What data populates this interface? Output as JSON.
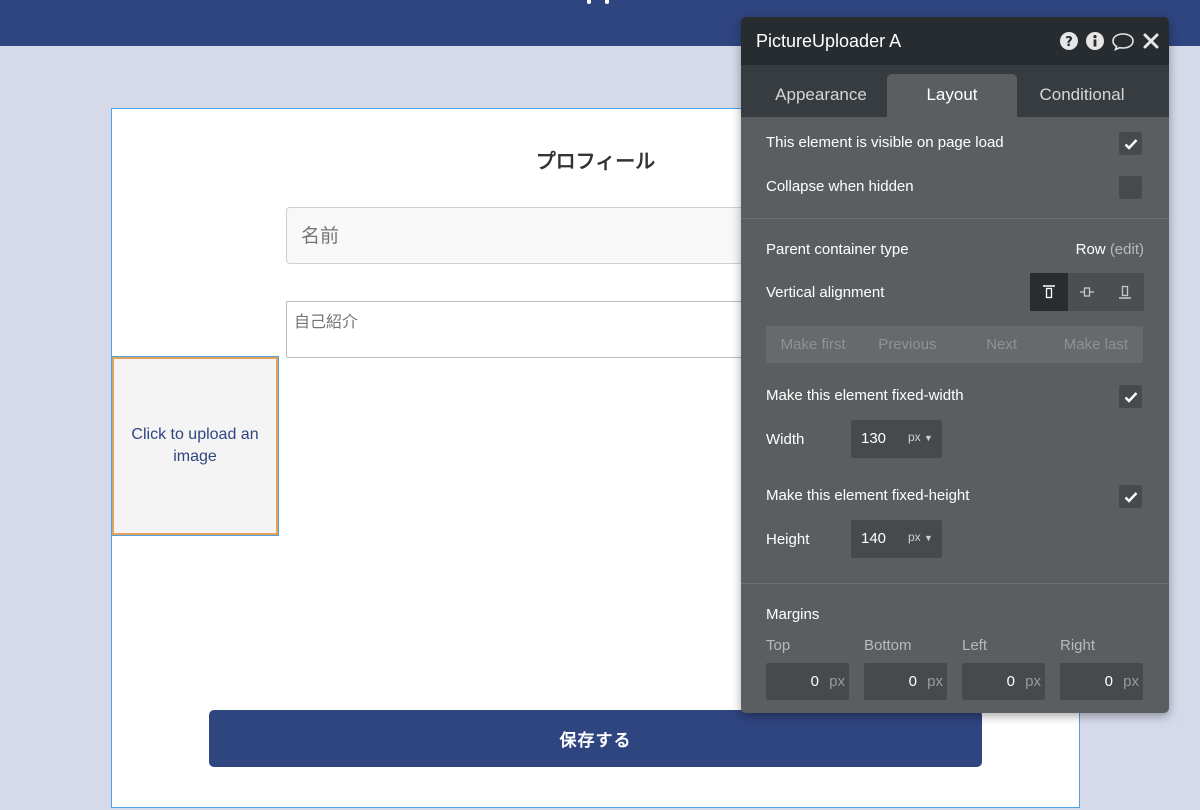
{
  "canvas": {
    "title": "プロフィール",
    "name_placeholder": "名前",
    "bio_placeholder": "自己紹介",
    "uploader_label": "Click to upload an image",
    "save_label": "保存する"
  },
  "panel": {
    "title": "PictureUploader A",
    "header_icons": [
      "help-icon",
      "info-icon",
      "comment-icon",
      "close-icon"
    ],
    "tabs": [
      {
        "label": "Appearance",
        "active": false
      },
      {
        "label": "Layout",
        "active": true
      },
      {
        "label": "Conditional",
        "active": false
      }
    ],
    "visible_on_load": {
      "label": "This element is visible on page load",
      "checked": true
    },
    "collapse_when_hidden": {
      "label": "Collapse when hidden",
      "checked": false
    },
    "parent_container": {
      "label": "Parent container type",
      "value": "Row",
      "edit": "(edit)"
    },
    "vertical_alignment": {
      "label": "Vertical alignment",
      "selected": "top",
      "options": [
        "top",
        "center",
        "bottom"
      ]
    },
    "order_buttons": [
      "Make first",
      "Previous",
      "Next",
      "Make last"
    ],
    "fixed_width": {
      "label": "Make this element fixed-width",
      "checked": true
    },
    "width": {
      "label": "Width",
      "value": "130",
      "unit": "px"
    },
    "fixed_height": {
      "label": "Make this element fixed-height",
      "checked": true
    },
    "height": {
      "label": "Height",
      "value": "140",
      "unit": "px"
    },
    "margins": {
      "title": "Margins",
      "fields": [
        {
          "label": "Top",
          "value": "0",
          "unit": "px"
        },
        {
          "label": "Bottom",
          "value": "0",
          "unit": "px"
        },
        {
          "label": "Left",
          "value": "0",
          "unit": "px"
        },
        {
          "label": "Right",
          "value": "0",
          "unit": "px"
        }
      ]
    }
  },
  "colors": {
    "header_bg": "#2f4580",
    "page_bg": "#d5d9ea",
    "panel_bg": "#5b5e60",
    "panel_header_bg": "#272c30",
    "selection_border": "#4aa3df",
    "uploader_border": "#e3a15a"
  }
}
